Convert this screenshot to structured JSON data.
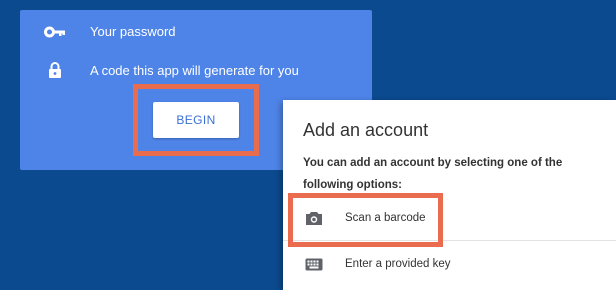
{
  "blue_card": {
    "items": [
      {
        "icon": "key-icon",
        "label": "Your password"
      },
      {
        "icon": "lock-icon",
        "label": "A code this app will generate for you"
      }
    ],
    "begin_label": "BEGIN"
  },
  "add_account": {
    "title": "Add an account",
    "description": "You can add an account by selecting one of the following options:",
    "options": [
      {
        "icon": "camera-icon",
        "label": "Scan a barcode"
      },
      {
        "icon": "keyboard-icon",
        "label": "Enter a provided key"
      }
    ]
  },
  "colors": {
    "background": "#0b4a8f",
    "card_blue": "#4e84e8",
    "highlight": "#e96c4f",
    "button_text": "#3b6fd8"
  }
}
